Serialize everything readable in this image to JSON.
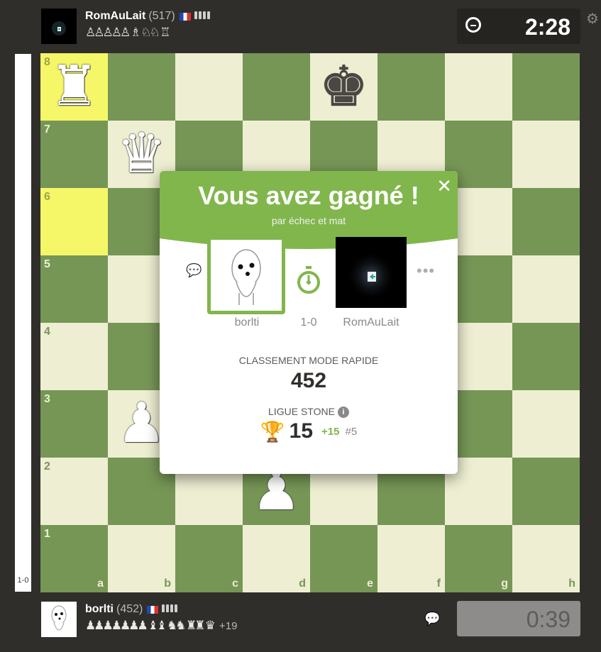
{
  "top_player": {
    "name": "RomAuLait",
    "rating": "(517)",
    "captured": "♙♙♙♙♙ ♗ ♘♘ ♖"
  },
  "top_clock": {
    "time": "2:28"
  },
  "bottom_player": {
    "name": "borlti",
    "rating": "(452)",
    "captured": "♟♟♟♟♟♟♟ ♝♝ ♞♞ ♜♜ ♛",
    "material_advantage": "+19"
  },
  "bottom_clock": {
    "time": "0:39"
  },
  "eval": {
    "score": "1-0",
    "white_advantage_fraction": 1.0
  },
  "board": {
    "ranks": [
      "8",
      "7",
      "6",
      "5",
      "4",
      "3",
      "2",
      "1"
    ],
    "files": [
      "a",
      "b",
      "c",
      "d",
      "e",
      "f",
      "g",
      "h"
    ],
    "highlighted_squares": [
      "a8",
      "a6"
    ],
    "pieces": [
      {
        "square": "a8",
        "color": "white",
        "type": "rook",
        "glyph": "♜"
      },
      {
        "square": "e8",
        "color": "black",
        "type": "king",
        "glyph": "♚"
      },
      {
        "square": "b7",
        "color": "white",
        "type": "queen",
        "glyph": "♛"
      },
      {
        "square": "b3",
        "color": "white",
        "type": "pawn",
        "glyph": "♟"
      },
      {
        "square": "d2",
        "color": "white",
        "type": "pawn",
        "glyph": "♟"
      }
    ]
  },
  "result_modal": {
    "title": "Vous avez gagné !",
    "subtitle": "par échec et mat",
    "player_name": "borlti",
    "opponent_name": "RomAuLait",
    "score": "1-0",
    "rating_label": "CLASSEMENT MODE RAPIDE",
    "rating_value": "452",
    "league_label": "LIGUE STONE",
    "league_points": "15",
    "league_gain": "+15",
    "league_rank": "#5"
  },
  "colors": {
    "light_square": "#eeeed2",
    "dark_square": "#769656",
    "highlight": "#f6f669",
    "accent_green": "#81b64c",
    "background": "#302e2b"
  }
}
